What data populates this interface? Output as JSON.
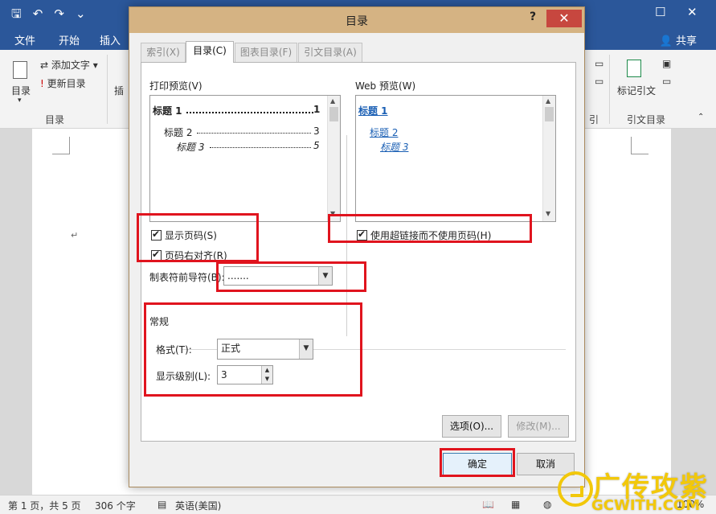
{
  "word": {
    "tabs": [
      "文件",
      "开始",
      "插入"
    ],
    "share": "共享",
    "ribbon": {
      "toc_button": "目录",
      "add_text": "添加文字",
      "update_toc": "更新目录",
      "insert_partial": "插",
      "group_toc": "目录",
      "mark_citation": "标记引文",
      "group_citation_toc": "引文目录",
      "partial_right": "引"
    },
    "status": {
      "page": "第 1 页，共 5 页",
      "words": "306 个字",
      "language": "英语(美国)",
      "zoom": "100%"
    }
  },
  "dialog": {
    "title": "目录",
    "help": "?",
    "close": "✕",
    "tabs": [
      {
        "label": "索引(X)",
        "active": false
      },
      {
        "label": "目录(C)",
        "active": true
      },
      {
        "label": "图表目录(F)",
        "active": false
      },
      {
        "label": "引文目录(A)",
        "active": false
      }
    ],
    "print_preview": {
      "label": "打印预览(V)",
      "lines": [
        {
          "text": "标题 1",
          "page": "1"
        },
        {
          "text": "标题 2",
          "page": "3"
        },
        {
          "text": "标题 3",
          "page": "5"
        }
      ]
    },
    "web_preview": {
      "label": "Web 预览(W)",
      "lines": [
        "标题 1",
        "标题 2",
        "标题 3"
      ]
    },
    "show_page_numbers": {
      "label": "显示页码(S)",
      "checked": true
    },
    "right_align": {
      "label": "页码右对齐(R)",
      "checked": true
    },
    "use_hyperlinks": {
      "label": "使用超链接而不使用页码(H)",
      "checked": true
    },
    "tab_leader": {
      "label": "制表符前导符(B):",
      "value": "......."
    },
    "general": {
      "title": "常规",
      "format_label": "格式(T):",
      "format_value": "正式",
      "levels_label": "显示级别(L):",
      "levels_value": "3"
    },
    "options_button": "选项(O)...",
    "modify_button": "修改(M)...",
    "ok_button": "确定",
    "cancel_button": "取消"
  },
  "watermark": {
    "cn": "广传攻紫",
    "en": "GCWITH.COM"
  }
}
